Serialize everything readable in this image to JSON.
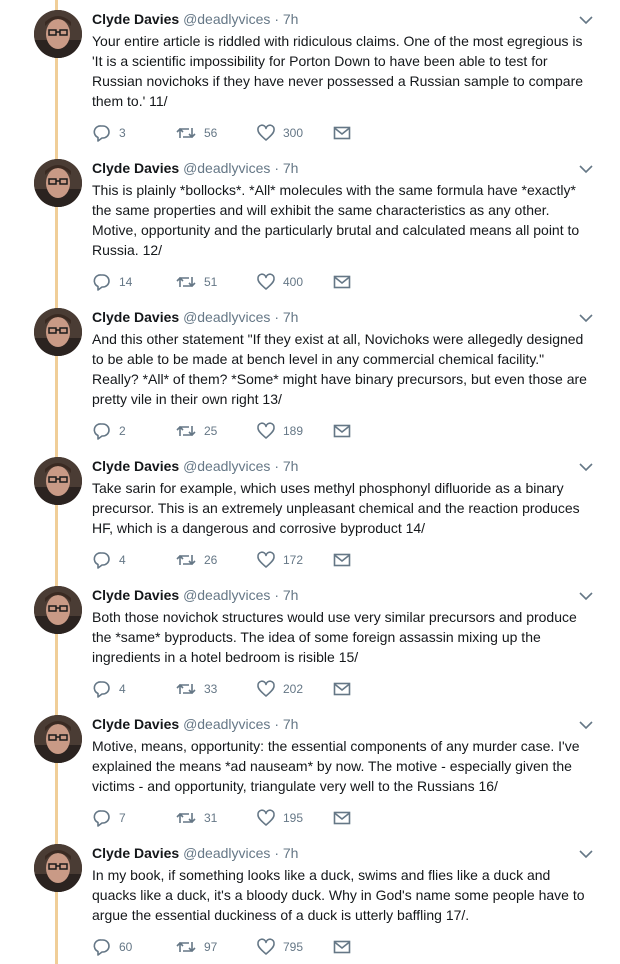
{
  "colors": {
    "thread_line": "#f0ce98",
    "secondary_text": "#657786",
    "primary_text": "#14171a"
  },
  "icons": {
    "reply": "reply-icon",
    "retweet": "retweet-icon",
    "like": "heart-icon",
    "dm": "envelope-icon",
    "menu": "chevron-down-icon"
  },
  "tweets": [
    {
      "name": "Clyde Davies",
      "handle": "@deadlyvices",
      "dot": "·",
      "time": "7h",
      "text": "Your entire article is riddled with ridiculous claims.  One of the most egregious is\n'It is a scientific impossibility for Porton Down to have been able to test for\nRussian novichoks if they have never possessed a Russian sample to compare\nthem to.' 11/",
      "replies": "3",
      "retweets": "56",
      "likes": "300"
    },
    {
      "name": "Clyde Davies",
      "handle": "@deadlyvices",
      "dot": "·",
      "time": "7h",
      "text": "This is plainly *bollocks*.  *All* molecules with the same formula have *exactly*\nthe same properties and will exhibit the same characteristics as any other.\nMotive, opportunity and the particularly brutal and calculated means all point to\nRussia. 12/",
      "replies": "14",
      "retweets": "51",
      "likes": "400"
    },
    {
      "name": "Clyde Davies",
      "handle": "@deadlyvices",
      "dot": "·",
      "time": "7h",
      "text": "And this other statement \"If they exist at all, Novichoks were allegedly designed\nto be able to be made at bench level in any commercial chemical facility.\"\nReally?  *All* of them?  *Some* might have binary precursors, but even those are\npretty vile in their own right 13/",
      "replies": "2",
      "retweets": "25",
      "likes": "189"
    },
    {
      "name": "Clyde Davies",
      "handle": "@deadlyvices",
      "dot": "·",
      "time": "7h",
      "text": "Take sarin for example, which uses methyl phosphonyl difluoride as a binary\nprecursor.  This is an extremely unpleasant chemical and the reaction produces\nHF, which is a dangerous and corrosive byproduct 14/",
      "replies": "4",
      "retweets": "26",
      "likes": "172"
    },
    {
      "name": "Clyde Davies",
      "handle": "@deadlyvices",
      "dot": "·",
      "time": "7h",
      "text": "Both those novichok structures would use very similar precursors and produce\nthe *same* byproducts.  The idea of some foreign assassin mixing up the\ningredients in a  hotel bedroom is risible 15/",
      "replies": "4",
      "retweets": "33",
      "likes": "202"
    },
    {
      "name": "Clyde Davies",
      "handle": "@deadlyvices",
      "dot": "·",
      "time": "7h",
      "text": "Motive, means, opportunity:  the essential components of any murder case.  I've\nexplained the means *ad nauseam* by now.  The motive - especially given the\nvictims - and opportunity, triangulate very well to the Russians 16/",
      "replies": "7",
      "retweets": "31",
      "likes": "195"
    },
    {
      "name": "Clyde Davies",
      "handle": "@deadlyvices",
      "dot": "·",
      "time": "7h",
      "text": "In my book, if something looks like a duck, swims and flies like a duck and\nquacks like a duck, it's a bloody duck.  Why in God's name some people have to\nargue the essential duckiness of a duck is utterly baffling 17/.",
      "replies": "60",
      "retweets": "97",
      "likes": "795"
    }
  ]
}
